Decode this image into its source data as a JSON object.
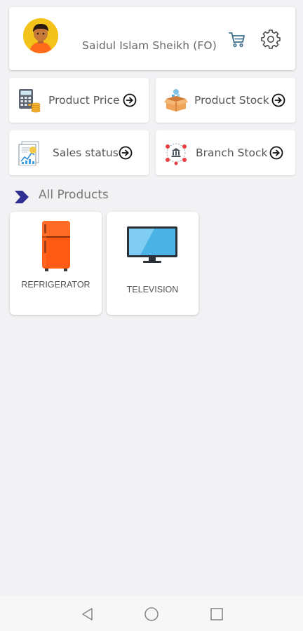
{
  "profile": {
    "name": "Saidul Islam Sheikh (FO)",
    "icons": {
      "avatar": "person-avatar",
      "cart": "cart-icon",
      "settings": "gear-icon"
    }
  },
  "menu": [
    {
      "label": "Product Price",
      "icon": "calculator-coins-icon"
    },
    {
      "label": "Product Stock",
      "icon": "open-box-icon"
    },
    {
      "label": "Sales status",
      "icon": "sales-report-icon"
    },
    {
      "label": "Branch Stock",
      "icon": "branch-bank-icon"
    }
  ],
  "section": {
    "title": "All Products"
  },
  "products": [
    {
      "label": "REFRIGERATOR",
      "icon": "refrigerator-icon"
    },
    {
      "label": "TELEVISION",
      "icon": "television-icon"
    }
  ],
  "colors": {
    "background": "#f2f1f3",
    "card": "#ffffff",
    "accent_chevron": "#2e3192",
    "fridge": "#ff5a14",
    "tv": "#4ab3e6"
  }
}
